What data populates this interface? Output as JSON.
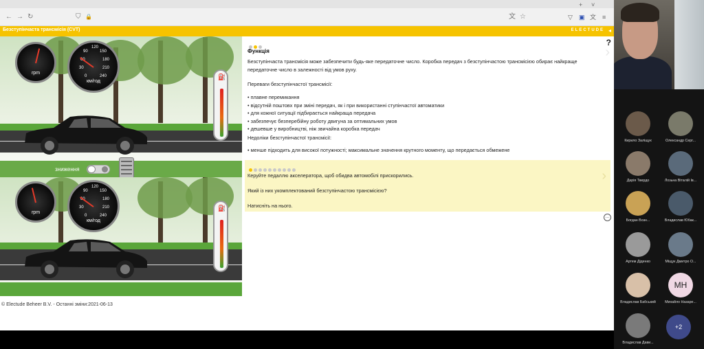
{
  "app": {
    "title": "Безступінчаста трансмісія (CVT)",
    "brand": "ELECTUDE",
    "collapse_glyph": "◂"
  },
  "browser": {
    "icons": [
      "back-icon",
      "forward-icon",
      "reload-icon",
      "shield-icon",
      "lock-icon",
      "translate-icon",
      "star-icon",
      "pocket-icon",
      "extension-icon",
      "translate-icon",
      "menu-icon",
      "new-tab-icon",
      "chevron-down-icon"
    ],
    "glyphs": {
      "back": "←",
      "forward": "→",
      "reload": "↻",
      "shield": "⛉",
      "lock": "🔒",
      "translate": "文",
      "star": "☆",
      "pocket": "▽",
      "ext": "▣",
      "menu": "≡",
      "newtab": "+",
      "chevron": "˅"
    }
  },
  "simulation": {
    "top": {
      "rpm_label": "rpm",
      "speed_label": "км/год",
      "rpm_ticks": [
        "1",
        "2",
        "3",
        "4",
        "5",
        "6",
        "7"
      ],
      "speed_ticks": [
        "0",
        "30",
        "60",
        "90",
        "120",
        "150",
        "180",
        "210",
        "240"
      ],
      "rpm_level": 0.55,
      "speed_level": 0.3,
      "fuel_level": 0.92
    },
    "bottom": {
      "rpm_label": "rpm",
      "speed_label": "км/год",
      "rpm_ticks": [
        "1",
        "2",
        "3",
        "4",
        "5",
        "6",
        "7"
      ],
      "speed_ticks": [
        "0",
        "30",
        "60",
        "90",
        "120",
        "150",
        "180",
        "210",
        "240"
      ],
      "rpm_level": 0.45,
      "speed_level": 0.3,
      "fuel_level": 0.92
    },
    "toggle_label": "зниження",
    "footer": "© Electude Beheer B.V. - Останні зміни:2021-06-13"
  },
  "content": {
    "help": "?",
    "heading": "Функція",
    "intro": "Безступінчаста трансмісія може забезпечити будь-яке передаточне число. Коробка передач з безступінчастою трансмісією обирає найкраще передаточне число в залежності від умов руху.",
    "advantages_title": "Переваги безступінчастої трансмісії:",
    "advantages": [
      "плавне перемикання",
      "відсутній поштовх при зміні передач, як і при використанні ступінчастої автоматики",
      "для кожної ситуації підбирається найкраща передача",
      "забезпечує безперебійну роботу двигуна за оптимальних умов",
      "дешевше у виробництві, ніж звичайна коробка передач"
    ],
    "disadvantages_title": "Недоліки безступінчастої трансмісії:",
    "disadvantages": [
      "менше підходить для високої потужності; максимальне значення крутного моменту, що передається обмежене"
    ],
    "task": {
      "line1": "Керуйте педаллю акселератора, щоб обидва автомобілі прискорились.",
      "line2": "Який із них укомплектований безступінчастою трансмісією?",
      "line3": "Натисніть на нього."
    }
  },
  "participants": [
    {
      "name": "Кирило Заліщук",
      "color": "#6b5a4a",
      "initials": ""
    },
    {
      "name": "Олександр Серг...",
      "color": "#7a7a6a",
      "initials": ""
    },
    {
      "name": "Дарія Твердо",
      "color": "#8a7a6a",
      "initials": ""
    },
    {
      "name": "Лозьна Віталій Ів...",
      "color": "#5a6a7a",
      "initials": ""
    },
    {
      "name": "Богдан Возн...",
      "color": "#c9a255",
      "initials": ""
    },
    {
      "name": "Владислав Юбак...",
      "color": "#4a5a6a",
      "initials": ""
    },
    {
      "name": "Артем Діденко",
      "color": "#9a9a9a",
      "initials": ""
    },
    {
      "name": "Міщук Дмитро О...",
      "color": "#6a7a8a",
      "initials": ""
    },
    {
      "name": "Владислав Бабський",
      "color": "#d8c0a8",
      "initials": ""
    },
    {
      "name": "Михайло Назаре...",
      "color": "#f0d8e4",
      "initials": "МН"
    },
    {
      "name": "Владислав Дави...",
      "color": "#7a7a7a",
      "initials": ""
    }
  ],
  "more_participants": "+2",
  "colors": {
    "accent": "#f6c300",
    "task_bg": "#fbf6c4"
  }
}
